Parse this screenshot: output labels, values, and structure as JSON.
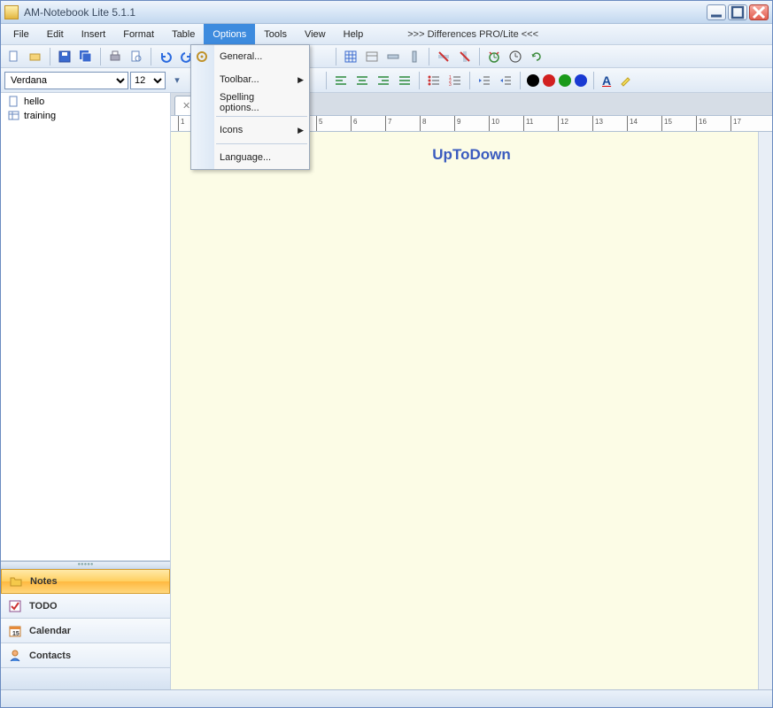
{
  "window": {
    "title": "AM-Notebook Lite  5.1.1"
  },
  "menubar": {
    "items": [
      "File",
      "Edit",
      "Insert",
      "Format",
      "Table",
      "Options",
      "Tools",
      "View",
      "Help"
    ],
    "active_index": 5,
    "extra_text": ">>> Differences PRO/Lite <<<"
  },
  "dropdown": {
    "items": [
      {
        "label": "General...",
        "has_icon": true
      },
      {
        "label": "Toolbar...",
        "has_submenu": true
      },
      {
        "label": "Spelling options..."
      },
      {
        "sep": true
      },
      {
        "label": "Icons",
        "has_submenu": true
      },
      {
        "sep": true
      },
      {
        "label": "Language..."
      }
    ]
  },
  "toolbar2": {
    "font": "Verdana",
    "size": "12",
    "swatches": [
      "#000000",
      "#d22020",
      "#1a9a1a",
      "#1a3ad2"
    ],
    "font_color_label": "A"
  },
  "sidebar": {
    "tree": [
      {
        "label": "hello",
        "icon": "note"
      },
      {
        "label": "training",
        "icon": "table"
      }
    ],
    "nav": [
      {
        "label": "Notes",
        "selected": true,
        "icon": "folder"
      },
      {
        "label": "TODO",
        "icon": "check"
      },
      {
        "label": "Calendar",
        "icon": "calendar"
      },
      {
        "label": "Contacts",
        "icon": "person"
      }
    ]
  },
  "editor": {
    "ruler_max": 17,
    "content": "UpToDown"
  }
}
